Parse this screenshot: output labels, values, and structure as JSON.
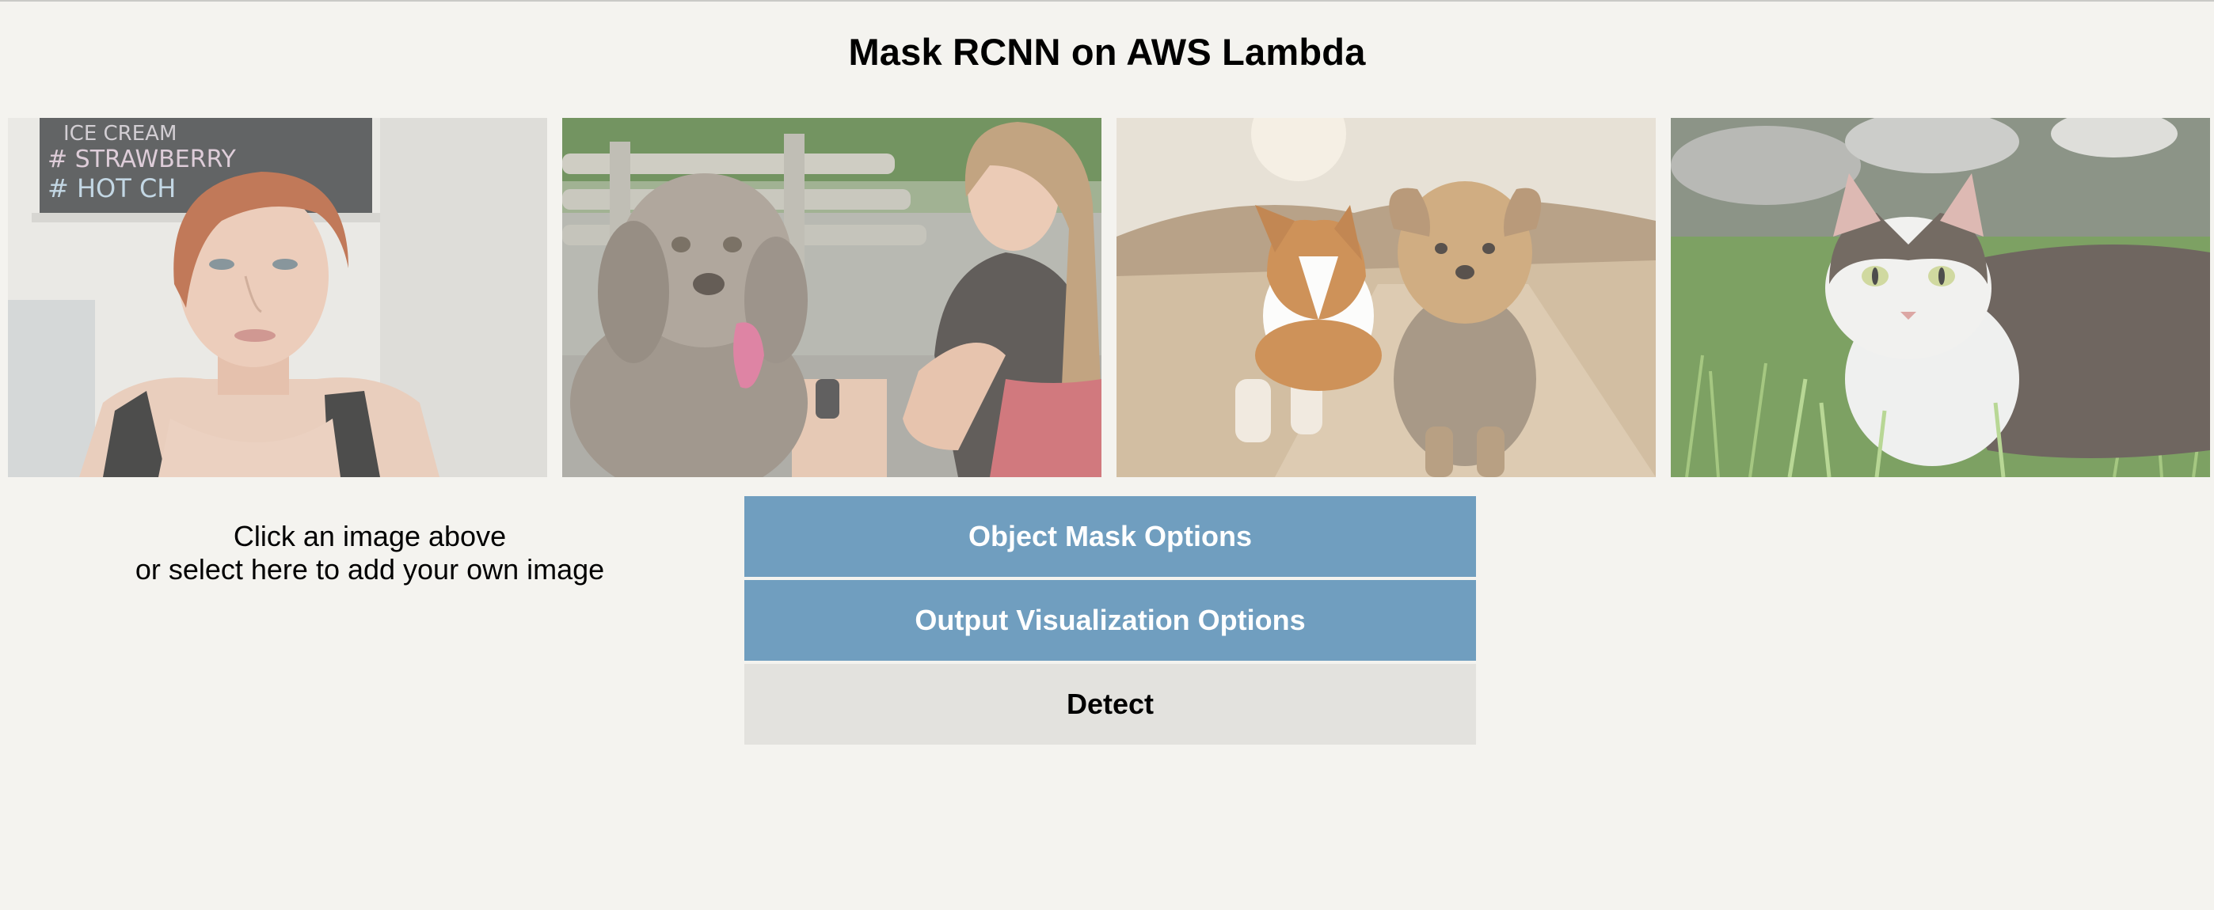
{
  "page": {
    "title": "Mask RCNN on AWS Lambda"
  },
  "gallery": {
    "images": [
      {
        "name": "woman-portrait",
        "chalkboard_text": [
          "ICE CREAM",
          "# STRAWBERRY",
          "# HOT CH"
        ]
      },
      {
        "name": "woman-with-dog"
      },
      {
        "name": "two-dogs-running"
      },
      {
        "name": "cat-in-grass"
      }
    ]
  },
  "prompt": {
    "line1": "Click an image above",
    "line2": "or select here to add your own image"
  },
  "controls": {
    "object_mask_label": "Object Mask Options",
    "output_viz_label": "Output Visualization Options",
    "detect_label": "Detect"
  },
  "colors": {
    "background": "#f4f3ef",
    "accordion": "#709ebf",
    "accordion_text": "#ffffff",
    "detect_bg": "#e3e2de"
  }
}
